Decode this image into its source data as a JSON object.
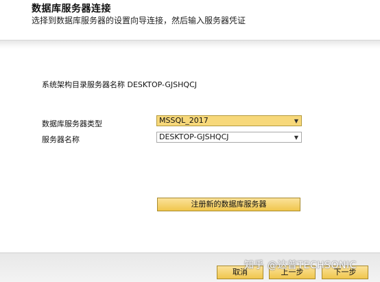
{
  "header": {
    "title": "数据库服务器连接",
    "subtitle": "选择到数据库服务器的设置向导连接，然后输入服务器凭证"
  },
  "form": {
    "catalog_server_text": "系统架构目录服务器名称 DESKTOP-GJSHQCJ",
    "db_type_label": "数据库服务器类型",
    "db_type_value": "MSSQL_2017",
    "server_name_label": "服务器名称",
    "server_name_value": "DESKTOP-GJSHQCJ",
    "register_button": "注册新的数据库服务器"
  },
  "footer": {
    "cancel_label": "取消",
    "back_label": "上一步",
    "next_label": "下一步"
  },
  "watermark": {
    "text": "知乎 @达普TECHSONIC"
  },
  "colors": {
    "highlight": "#f7d87a",
    "button": "#f0c64d"
  }
}
